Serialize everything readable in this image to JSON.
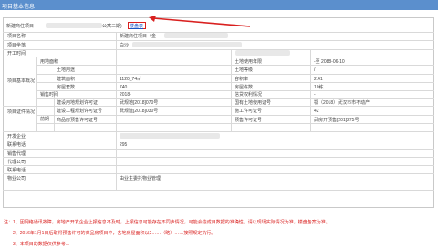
{
  "window": {
    "title": "项目基本信息"
  },
  "header": {
    "project_label": "新建商住项目",
    "project_value_suffix": "公寓二期)",
    "link_label": "楼盘表"
  },
  "rows": {
    "project_name": {
      "label": "项目名称",
      "value": "新建商住项目（金"
    },
    "project_location": {
      "label": "项目坐落",
      "value": "白沙"
    },
    "open_time": {
      "label": "开工时间"
    },
    "land_area": {
      "label": "用地面积"
    },
    "land_use_period": {
      "label": "土地使用年限",
      "value": "-至 2088-06-10"
    },
    "land_use": {
      "label": "土地用途"
    },
    "land_grade": {
      "label": "土地等级",
      "value": "/"
    },
    "building_area": {
      "label": "建筑面积",
      "value": "1120_74㎡"
    },
    "plot_ratio": {
      "label": "容积率",
      "value": "2.41"
    },
    "house_count": {
      "label": "房屋套数",
      "value": "740"
    },
    "building_count": {
      "label": "房屋栋数",
      "value": "10栋"
    },
    "sales_time": {
      "label": "销售时间",
      "value": "2018-"
    },
    "finance": {
      "label": "信贷权利情况",
      "value": "-"
    },
    "planning_permit": {
      "label": "建设用地规划许可证",
      "value": "武规地[2018]070号",
      "right_label": "国有土地使用证号",
      "right_value": "鄂（2018）武汉市市不动产"
    },
    "construction_permit": {
      "label": "建设工程规划许可证号",
      "value": "武规建[2018]030号",
      "right_label": "施工许可证号",
      "right_value": "42"
    },
    "presale_permit": {
      "label": "商品房预售许可证号",
      "right_label": "预售许可证号",
      "right_value": "武房开预售[201]275号"
    },
    "developer": {
      "label": "开发企业"
    },
    "contact": {
      "label": "联系电话",
      "value": "295"
    },
    "sales_agent": {
      "label": "销售代理"
    },
    "agent_company": {
      "label": "代理公司"
    },
    "agent_phone": {
      "label": "联系电话"
    },
    "property_company": {
      "label": "物业公司",
      "value": "由业主委托物业管理"
    }
  },
  "group_labels": {
    "basic": "项目基本概况",
    "certificates": "项目证件情况",
    "pre_label": "前期"
  },
  "notes": [
    "注：1、因网络通讯故障，房地产开发企业上报信息不及时，上报信息可能存在不同步情况，可能会造成目数据的准确性，请以现场实际情况为准，楼盘备案为准。",
    "2、2016年1月1日后取得预售许可的商品房项目中，各地房屋面积以2……（略）……按照规定执行。",
    "3、本项目的数据仅供参考..."
  ]
}
